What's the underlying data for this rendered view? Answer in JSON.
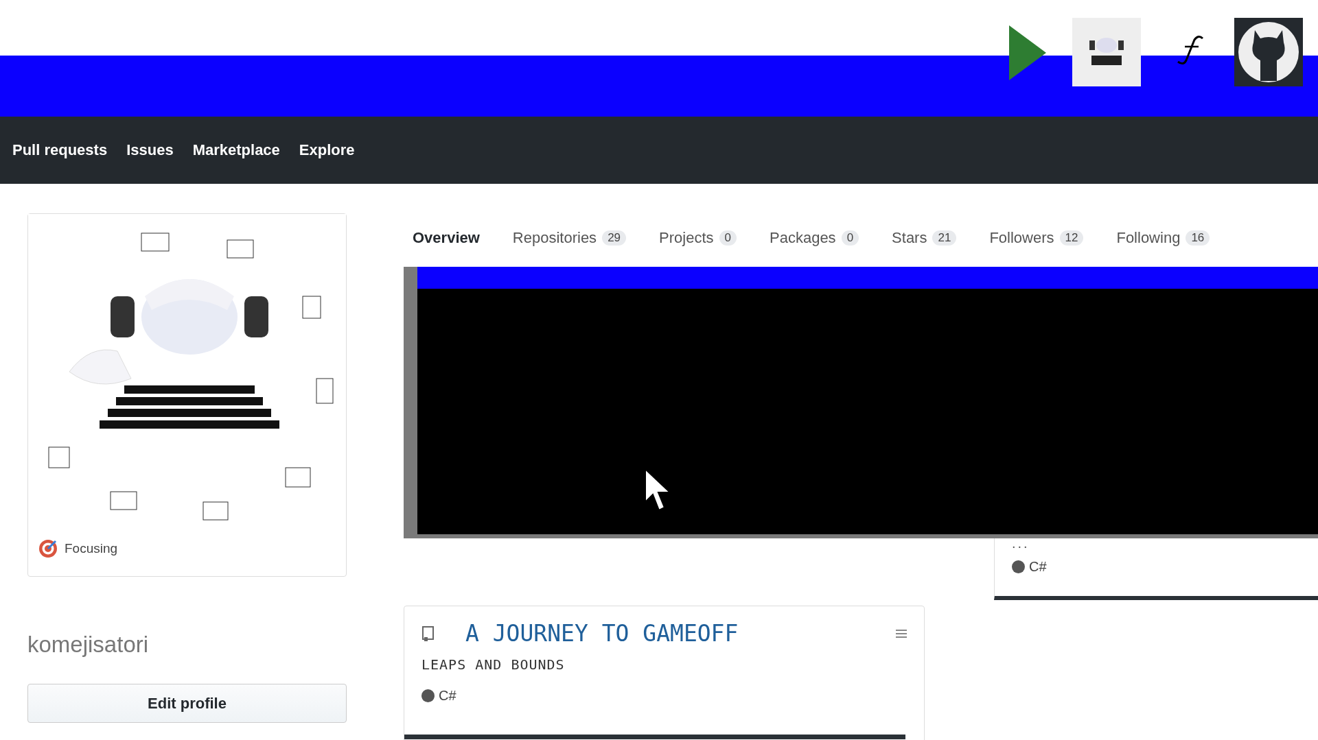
{
  "nav": {
    "items": [
      "Pull requests",
      "Issues",
      "Marketplace",
      "Explore"
    ]
  },
  "profile": {
    "status": "Focusing",
    "username": "komejisatori",
    "edit_button": "Edit profile"
  },
  "tabs": [
    {
      "label": "Overview",
      "selected": true
    },
    {
      "label": "Repositories",
      "count": "29",
      "selected": false
    },
    {
      "label": "Projects",
      "count": "0",
      "selected": false
    },
    {
      "label": "Packages",
      "count": "0",
      "selected": false
    },
    {
      "label": "Stars",
      "count": "21",
      "selected": false
    },
    {
      "label": "Followers",
      "count": "12",
      "selected": false
    },
    {
      "label": "Following",
      "count": "16",
      "selected": false
    }
  ],
  "partial_card": {
    "more": "...",
    "language": "C#"
  },
  "pinned_card": {
    "title": "A JOURNEY TO GAMEOFF",
    "description": "LEAPS AND BOUNDS",
    "language": "C#"
  }
}
